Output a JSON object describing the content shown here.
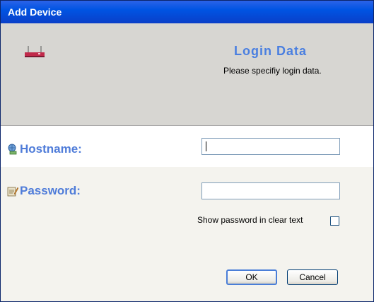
{
  "window": {
    "title": "Add Device"
  },
  "header": {
    "title": "Login Data",
    "subtitle": "Please specifiy login data."
  },
  "hostname": {
    "label": "Hostname:",
    "value": ""
  },
  "password": {
    "label": "Password:",
    "value": ""
  },
  "show_password": {
    "label": "Show password in clear text",
    "checked": false
  },
  "buttons": {
    "ok": "OK",
    "cancel": "Cancel"
  },
  "colors": {
    "title_bar": "#0054e3",
    "accent_text": "#4f7cd9",
    "header_bg": "#d7d6d2"
  }
}
